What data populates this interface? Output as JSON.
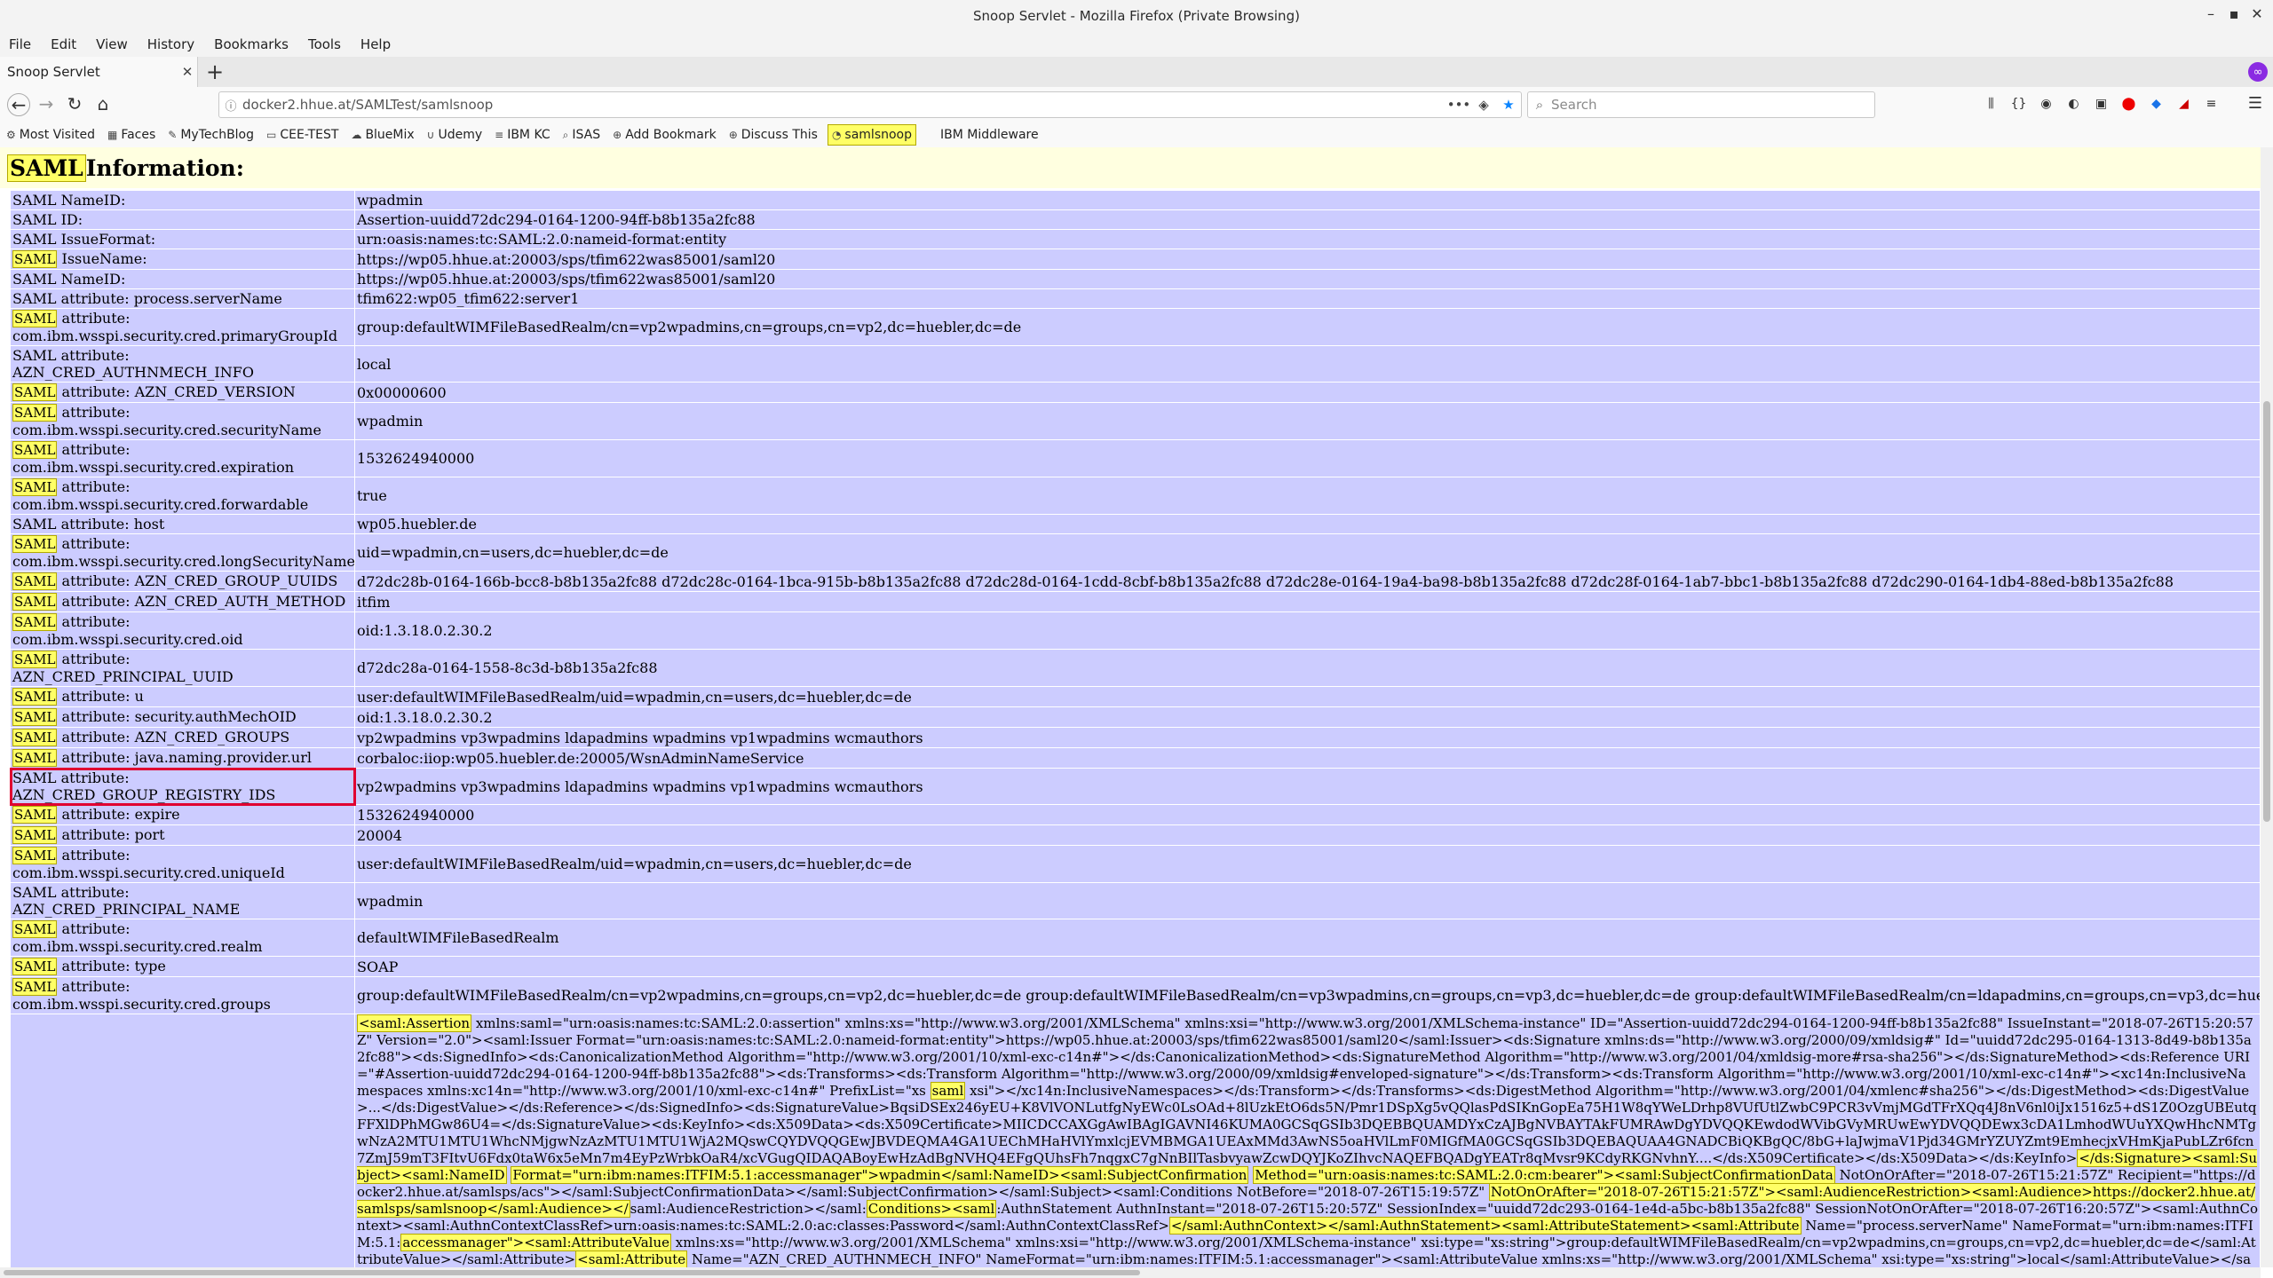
{
  "window": {
    "title": "Snoop Servlet - Mozilla Firefox (Private Browsing)"
  },
  "menu": [
    "File",
    "Edit",
    "View",
    "History",
    "Bookmarks",
    "Tools",
    "Help"
  ],
  "tab": {
    "label": "Snoop Servlet",
    "close": "✕",
    "new_tab": "+"
  },
  "nav": {
    "url": "docker2.hhue.at/SAMLTest/samlsnoop",
    "search_placeholder": "Search"
  },
  "bookmarks": [
    "Most Visited",
    "Faces",
    "MyTechBlog",
    "CEE-TEST",
    "BlueMix",
    "Udemy",
    "IBM KC",
    "ISAS",
    "Add Bookmark",
    "Discuss This",
    "samlsnoop",
    "IBM Middleware"
  ],
  "page": {
    "heading_mark": "SAML",
    "heading_rest": " Information:",
    "rows": [
      {
        "k_pre": "",
        "k_rest": "SAML NameID:",
        "v": "wpadmin"
      },
      {
        "k_pre": "",
        "k_rest": "SAML ID:",
        "v": "Assertion-uuidd72dc294-0164-1200-94ff-b8b135a2fc88"
      },
      {
        "k_pre": "",
        "k_rest": "SAML IssueFormat:",
        "v": "urn:oasis:names:tc:SAML:2.0:nameid-format:entity"
      },
      {
        "k_pre": "SAML",
        "k_rest": " IssueName:",
        "v": "https://wp05.hhue.at:20003/sps/tfim622was85001/saml20"
      },
      {
        "k_pre": "",
        "k_rest": "SAML NameID:",
        "v": "https://wp05.hhue.at:20003/sps/tfim622was85001/saml20"
      },
      {
        "k_pre": "",
        "k_rest": "SAML attribute: process.serverName",
        "v": "tfim622:wp05_tfim622:server1"
      },
      {
        "k_pre": "SAML",
        "k_rest": " attribute:",
        "k2": "com.ibm.wsspi.security.cred.primaryGroupId",
        "v": "group:defaultWIMFileBasedRealm/cn=vp2wpadmins,cn=groups,cn=vp2,dc=huebler,dc=de"
      },
      {
        "k_pre": "",
        "k_rest": "SAML attribute:",
        "k2": "AZN_CRED_AUTHNMECH_INFO",
        "v": "local"
      },
      {
        "k_pre": "SAML",
        "k_rest": " attribute: AZN_CRED_VERSION",
        "v": "0x00000600"
      },
      {
        "k_pre": "SAML",
        "k_rest": " attribute:",
        "k2": "com.ibm.wsspi.security.cred.securityName",
        "v": "wpadmin"
      },
      {
        "k_pre": "SAML",
        "k_rest": " attribute:",
        "k2": "com.ibm.wsspi.security.cred.expiration",
        "v": "1532624940000"
      },
      {
        "k_pre": "SAML",
        "k_rest": " attribute:",
        "k2": "com.ibm.wsspi.security.cred.forwardable",
        "v": "true"
      },
      {
        "k_pre": "",
        "k_rest": "SAML attribute: host",
        "v": "wp05.huebler.de"
      },
      {
        "k_pre": "SAML",
        "k_rest": " attribute:",
        "k2": "com.ibm.wsspi.security.cred.longSecurityName",
        "v": "uid=wpadmin,cn=users,dc=huebler,dc=de"
      },
      {
        "k_pre": "SAML",
        "k_rest": " attribute: AZN_CRED_GROUP_UUIDS",
        "v": "d72dc28b-0164-166b-bcc8-b8b135a2fc88 d72dc28c-0164-1bca-915b-b8b135a2fc88 d72dc28d-0164-1cdd-8cbf-b8b135a2fc88 d72dc28e-0164-19a4-ba98-b8b135a2fc88 d72dc28f-0164-1ab7-bbc1-b8b135a2fc88 d72dc290-0164-1db4-88ed-b8b135a2fc88"
      },
      {
        "k_pre": "SAML",
        "k_rest": " attribute: AZN_CRED_AUTH_METHOD",
        "v": "itfim"
      },
      {
        "k_pre": "SAML",
        "k_rest": " attribute:",
        "k2": "com.ibm.wsspi.security.cred.oid",
        "v": "oid:1.3.18.0.2.30.2"
      },
      {
        "k_pre": "SAML",
        "k_rest": " attribute:",
        "k2": "AZN_CRED_PRINCIPAL_UUID",
        "v": "d72dc28a-0164-1558-8c3d-b8b135a2fc88"
      },
      {
        "k_pre": "SAML",
        "k_rest": " attribute: u",
        "v": "user:defaultWIMFileBasedRealm/uid=wpadmin,cn=users,dc=huebler,dc=de"
      },
      {
        "k_pre": "SAML",
        "k_rest": " attribute: security.authMechOID",
        "v": "oid:1.3.18.0.2.30.2"
      },
      {
        "k_pre": "SAML",
        "k_rest": " attribute: AZN_CRED_GROUPS",
        "v": "vp2wpadmins vp3wpadmins ldapadmins wpadmins vp1wpadmins wcmauthors"
      },
      {
        "k_pre": "SAML",
        "k_rest": " attribute: java.naming.provider.url",
        "v": "corbaloc:iiop:wp05.huebler.de:20005/WsnAdminNameService"
      },
      {
        "k_pre": "",
        "k_rest": "SAML attribute:",
        "k2": "AZN_CRED_GROUP_REGISTRY_IDS",
        "v": "vp2wpadmins vp3wpadmins ldapadmins wpadmins vp1wpadmins wcmauthors",
        "selected": true
      },
      {
        "k_pre": "SAML",
        "k_rest": " attribute: expire",
        "v": "1532624940000"
      },
      {
        "k_pre": "SAML",
        "k_rest": " attribute: port",
        "v": "20004"
      },
      {
        "k_pre": "SAML",
        "k_rest": " attribute:",
        "k2": "com.ibm.wsspi.security.cred.uniqueId",
        "v": "user:defaultWIMFileBasedRealm/uid=wpadmin,cn=users,dc=huebler,dc=de"
      },
      {
        "k_pre": "",
        "k_rest": "SAML attribute:",
        "k2": "AZN_CRED_PRINCIPAL_NAME",
        "v": "wpadmin"
      },
      {
        "k_pre": "SAML",
        "k_rest": " attribute:",
        "k2": "com.ibm.wsspi.security.cred.realm",
        "v": "defaultWIMFileBasedRealm"
      },
      {
        "k_pre": "SAML",
        "k_rest": " attribute: type",
        "v": "SOAP"
      },
      {
        "k_pre": "SAML",
        "k_rest": " attribute:",
        "k2": "com.ibm.wsspi.security.cred.groups",
        "v": "group:defaultWIMFileBasedRealm/cn=vp2wpadmins,cn=groups,cn=vp2,dc=huebler,dc=de group:defaultWIMFileBasedRealm/cn=vp3wpadmins,cn=groups,cn=vp3,dc=huebler,dc=de group:defaultWIMFileBasedRealm/cn=ldapadmins,cn=groups,cn=vp3,dc=huebler,dc=de group:defaultWIMFileBasedRealm/cn=wpadmins,cn=groups,dc=huebler,dc=de"
      }
    ],
    "xml": [
      {
        "hl": true,
        "t": "<saml:Assertion"
      },
      {
        "hl": false,
        "t": " xmlns:saml=\"urn:oasis:names:tc:SAML:2.0:assertion\" xmlns:xs=\"http://www.w3.org/2001/XMLSchema\" xmlns:xsi=\"http://www.w3.org/2001/XMLSchema-instance\" ID=\"Assertion-uuidd72dc294-0164-1200-94ff-b8b135a2fc88\" IssueInstant=\"2018-07-26T15:20:57Z\" Version=\"2.0\"><saml:Issuer Format=\"urn:oasis:names:tc:SAML:2.0:nameid-format:entity\">https://wp05.hhue.at:20003/sps/tfim622was85001/saml20</saml:Issuer><ds:Signature xmlns:ds=\"http://www.w3.org/2000/09/xmldsig#\" Id=\"uuidd72dc295-0164-1313-8d49-b8b135a2fc88\"><ds:SignedInfo><ds:CanonicalizationMethod Algorithm=\"http://www.w3.org/2001/10/xml-exc-c14n#\"></ds:CanonicalizationMethod><ds:SignatureMethod Algorithm=\"http://www.w3.org/2001/04/xmldsig-more#rsa-sha256\"></ds:SignatureMethod><ds:Reference URI=\"#Assertion-uuidd72dc294-0164-1200-94ff-b8b135a2fc88\"><ds:Transforms><ds:Transform Algorithm=\"http://www.w3.org/2000/09/xmldsig#enveloped-signature\"></ds:Transform><ds:Transform Algorithm=\"http://www.w3.org/2001/10/xml-exc-c14n#\"><xc14n:InclusiveNamespaces xmlns:xc14n=\"http://www.w3.org/2001/10/xml-exc-c14n#\" PrefixList=\"xs "
      },
      {
        "hl": true,
        "t": "saml"
      },
      {
        "hl": false,
        "t": " xsi\"></xc14n:InclusiveNamespaces></ds:Transform></ds:Transforms><ds:DigestMethod Algorithm=\"http://www.w3.org/2001/04/xmlenc#sha256\"></ds:DigestMethod><ds:DigestValue>...</ds:DigestValue></ds:Reference></ds:SignedInfo><ds:SignatureValue>BqsiDSEx246yEU+K8VlVONLutfgNyEWc0LsOAd+8lUzkEtO6ds5N/Pmr1DSpXg5vQQlasPdSIKnGopEa75H1W8qYWeLDrhp8VUfUtlZwbC9PCR3vVmjMGdTFrXQq4J8nV6nl0iJx1516z5+dS1Z0OzgUBEutqFFXlDPhMGw86U4=</ds:SignatureValue><ds:KeyInfo><ds:X509Data><ds:X509Certificate>MIICDCCAXGgAwIBAgIGAVNI46KUMA0GCSqGSIb3DQEBBQUAMDYxCzAJBgNVBAYTAkFUMRAwDgYDVQQKEwdodWVibGVyMRUwEwYDVQQDEwx3cDA1LmhodWUuYXQwHhcNMTgwNzA2MTU1MTU1WhcNMjgwNzAzMTU1MTU1WjA2MQswCQYDVQQGEwJBVDEQMA4GA1UEChMHaHVlYmxlcjEVMBMGA1UEAxMMd3AwNS5oaHVlLmF0MIGfMA0GCSqGSIb3DQEBAQUAA4GNADCBiQKBgQC/8bG+laJwjmaV1Pjd34GMrYZUYZmt9EmhecjxVHmKjaPubLZr6fcn7ZmJ59mT3FItvU6Fdx0taW6x5eMn7m4EyPzWrbkOaR4/xcVGugQIDAQABoyEwHzAdBgNVHQ4EFgQUhsFh7nqgxC7gNnBIlTasbvyawZcwDQYJKoZIhvcNAQEFBQADgYEATr8qMvsr9KCdyRKGNvhnY....</ds:X509Certificate></ds:X509Data></ds:KeyInfo>"
      },
      {
        "hl": true,
        "t": "</ds:Signature><saml:Subject><saml:NameID"
      },
      {
        "hl": false,
        "t": " "
      },
      {
        "hl": true,
        "t": "Format=\"urn:ibm:names:ITFIM:5.1:accessmanager\">wpadmin</saml:NameID><saml:SubjectConfirmation"
      },
      {
        "hl": false,
        "t": " "
      },
      {
        "hl": true,
        "t": "Method=\"urn:oasis:names:tc:SAML:2.0:cm:bearer\"><saml:SubjectConfirmationData"
      },
      {
        "hl": false,
        "t": " NotOnOrAfter=\"2018-07-26T15:21:57Z\" Recipient=\"https://docker2.hhue.at/samlsps/acs\"></saml:SubjectConfirmationData></saml:SubjectConfirmation></saml:Subject><saml:Conditions NotBefore=\"2018-07-26T15:19:57Z\" "
      },
      {
        "hl": true,
        "t": "NotOnOrAfter=\"2018-07-26T15:21:57Z\"><saml:AudienceRestriction><saml:Audience>https://docker2.hhue.at/samlsps/samlsnoop</saml:Audience></"
      },
      {
        "hl": false,
        "t": "saml:AudienceRestriction></saml:"
      },
      {
        "hl": true,
        "t": "Conditions><saml"
      },
      {
        "hl": false,
        "t": ":AuthnStatement AuthnInstant=\"2018-07-26T15:20:57Z\" SessionIndex=\"uuidd72dc293-0164-1e4d-a5bc-b8b135a2fc88\" SessionNotOnOrAfter=\"2018-07-26T16:20:57Z\"><saml:AuthnContext><saml:AuthnContextClassRef>urn:oasis:names:tc:SAML:2.0:ac:classes:Password</saml:AuthnContextClassRef>"
      },
      {
        "hl": true,
        "t": "</saml:AuthnContext></saml:AuthnStatement><saml:AttributeStatement><saml:Attribute"
      },
      {
        "hl": false,
        "t": " Name=\"process.serverName\" NameFormat=\"urn:ibm:names:ITFIM:5.1:"
      },
      {
        "hl": true,
        "t": "accessmanager\"><saml:AttributeValue"
      },
      {
        "hl": false,
        "t": " xmlns:xs=\"http://www.w3.org/2001/XMLSchema\" xmlns:xsi=\"http://www.w3.org/2001/XMLSchema-instance\" xsi:type=\"xs:string\">group:defaultWIMFileBasedRealm/cn=vp2wpadmins,cn=groups,cn=vp2,dc=huebler,dc=de</saml:AttributeValue></saml:Attribute>"
      },
      {
        "hl": true,
        "t": "<saml:Attribute"
      },
      {
        "hl": false,
        "t": " Name=\"AZN_CRED_AUTHNMECH_INFO\" NameFormat=\"urn:ibm:names:ITFIM:5.1:accessmanager\"><saml:AttributeValue xmlns:xs=\"http://www.w3.org/2001/XMLSchema\" xsi:type=\"xs:string\">local</saml:AttributeValue></saml:Attribute><saml:Attribute Name=\"AZN_CRED_VERSION\" NameFormat=\"urn:ibm:names:ITFIM:5.1:accessmanager\"><saml:AttributeValue xmlns:xsi=\"http://www.w3.org/2001/XMLSchema-instance\" xsi:type=\"xs:string\">0x00000600</saml:AttributeValue></saml:Attribute><saml:Attribute Name=\"com.ibm.wsspi.security.cred.securityName\" NameFormat=\"urn:ibm:names:ITFIM:5.1:accessmanager\"><saml:AttributeValue>wpadmin</saml:AttributeValue></saml:Attribute>"
      }
    ]
  }
}
